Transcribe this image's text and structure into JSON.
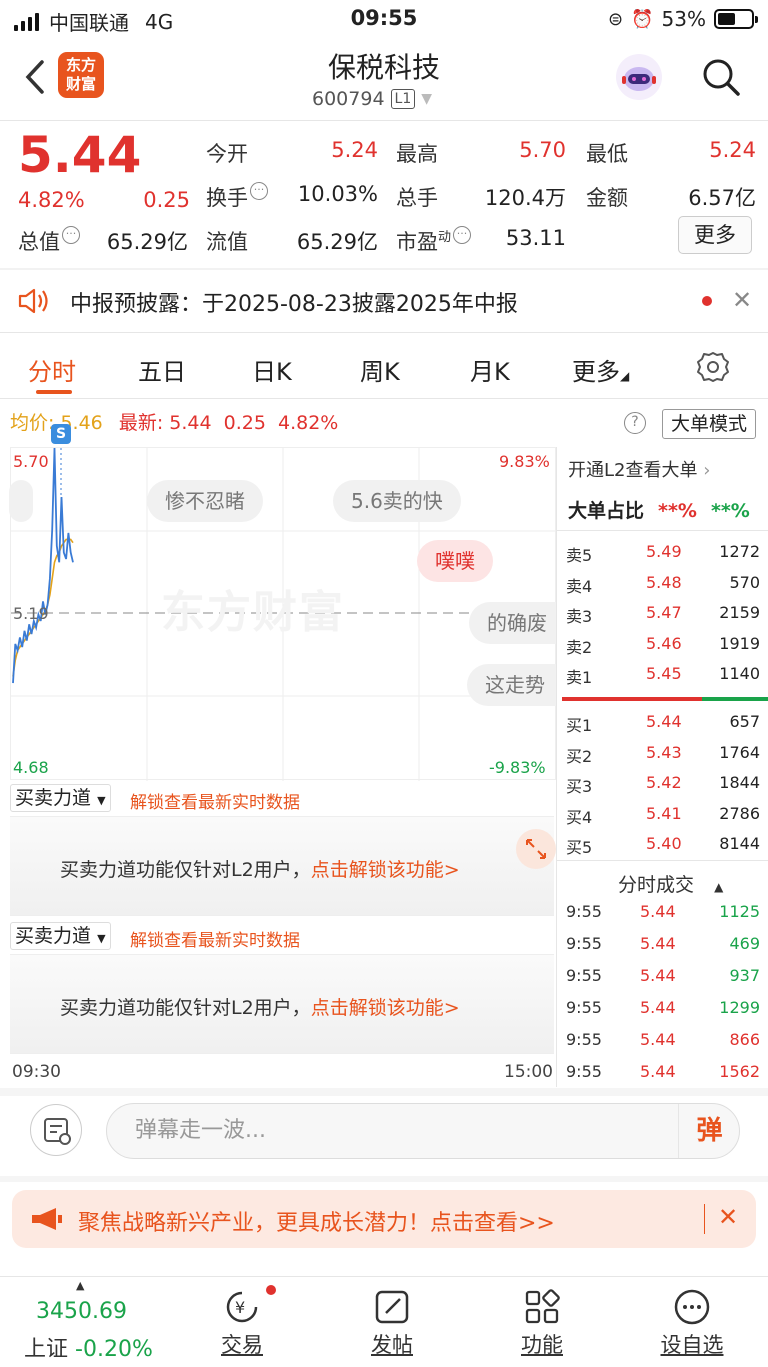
{
  "status": {
    "carrier": "中国联通",
    "network": "4G",
    "time": "09:55",
    "battery": "53%"
  },
  "header": {
    "logo": [
      "东方",
      "财富"
    ],
    "title": "保税科技",
    "code": "600794",
    "level": "L1"
  },
  "quote": {
    "price": "5.44",
    "change_pct": "4.82%",
    "change": "0.25",
    "row1": [
      {
        "l": "今开",
        "v": "5.24"
      },
      {
        "l": "最高",
        "v": "5.70"
      },
      {
        "l": "最低",
        "v": "5.24"
      }
    ],
    "row2": [
      {
        "l": "换手",
        "v": "10.03%"
      },
      {
        "l": "总手",
        "v": "120.4万"
      },
      {
        "l": "金额",
        "v": "6.57亿"
      }
    ],
    "row3": [
      {
        "l": "总值",
        "v": "65.29亿"
      },
      {
        "l": "流值",
        "v": "65.29亿"
      },
      {
        "l": "市盈",
        "sup": "动",
        "v": "53.11"
      }
    ],
    "more": "更多"
  },
  "notice": {
    "text": "中报预披露：于2025-08-23披露2025年中报"
  },
  "tabs": [
    "分时",
    "五日",
    "日K",
    "周K",
    "月K",
    "更多"
  ],
  "chart_info": {
    "avg_label": "均价:",
    "avg": "5.46",
    "latest_label": "最新:",
    "latest": "5.44",
    "chg": "0.25",
    "pct": "4.82%",
    "mode": "大单模式"
  },
  "chart": {
    "y_high": "5.70",
    "y_mid": "5.19",
    "y_low": "4.68",
    "pct_high": "9.83%",
    "pct_low": "-9.83%",
    "t_start": "09:30",
    "t_end": "15:00",
    "watermark": "东方财富",
    "badge": "S",
    "danmu": [
      "惨不忍睹",
      "5.6卖的快",
      "噗噗",
      "的确废",
      "这走势"
    ]
  },
  "chart_data": {
    "type": "line",
    "ylim": [
      4.68,
      5.7
    ],
    "series": [
      {
        "values": [
          4.98,
          5.1,
          5.08,
          5.12,
          5.09,
          5.14,
          5.11,
          5.16,
          5.13,
          5.17,
          5.15,
          5.19,
          5.17,
          5.23,
          5.19,
          5.22,
          5.3,
          5.45,
          5.7,
          5.4,
          5.35,
          5.55,
          5.38,
          5.36,
          5.44,
          5.38,
          5.35
        ]
      },
      {
        "values": [
          5.0,
          5.05,
          5.08,
          5.09,
          5.1,
          5.11,
          5.12,
          5.13,
          5.14,
          5.15,
          5.16,
          5.17,
          5.18,
          5.19,
          5.2,
          5.22,
          5.25,
          5.3,
          5.35,
          5.37,
          5.38,
          5.4,
          5.41,
          5.42,
          5.42,
          5.42,
          5.41
        ]
      }
    ]
  },
  "book": {
    "l2": "开通L2查看大单",
    "ratio_label": "大单占比",
    "ratio_red": "**%",
    "ratio_green": "**%",
    "asks": [
      {
        "n": "卖5",
        "p": "5.49",
        "v": "1272"
      },
      {
        "n": "卖4",
        "p": "5.48",
        "v": "570"
      },
      {
        "n": "卖3",
        "p": "5.47",
        "v": "2159"
      },
      {
        "n": "卖2",
        "p": "5.46",
        "v": "1919"
      },
      {
        "n": "卖1",
        "p": "5.45",
        "v": "1140"
      }
    ],
    "bids": [
      {
        "n": "买1",
        "p": "5.44",
        "v": "657"
      },
      {
        "n": "买2",
        "p": "5.43",
        "v": "1764"
      },
      {
        "n": "买3",
        "p": "5.42",
        "v": "1844"
      },
      {
        "n": "买4",
        "p": "5.41",
        "v": "2786"
      },
      {
        "n": "买5",
        "p": "5.40",
        "v": "8144"
      }
    ],
    "ticks_title": "分时成交",
    "ticks": [
      {
        "t": "9:55",
        "p": "5.44",
        "v": "1125",
        "c": "g"
      },
      {
        "t": "9:55",
        "p": "5.44",
        "v": "469",
        "c": "g"
      },
      {
        "t": "9:55",
        "p": "5.44",
        "v": "937",
        "c": "g"
      },
      {
        "t": "9:55",
        "p": "5.44",
        "v": "1299",
        "c": "g"
      },
      {
        "t": "9:55",
        "p": "5.44",
        "v": "866",
        "c": "r"
      },
      {
        "t": "9:55",
        "p": "5.44",
        "v": "1562",
        "c": "r"
      }
    ]
  },
  "l2panel": {
    "select": "买卖力道",
    "unlock": "解锁查看最新实时数据",
    "msg": "买卖力道功能仅针对L2用户，",
    "link": "点击解锁该功能>"
  },
  "comment": {
    "placeholder": "弹幕走一波...",
    "btn": "弹"
  },
  "banner": {
    "text": "聚焦战略新兴产业，更具成长潜力！点击查看>>"
  },
  "nav": {
    "index_value": "3450.69",
    "index_name": "上证",
    "index_chg": "-0.20%",
    "items": [
      "交易",
      "发帖",
      "功能",
      "设自选"
    ]
  },
  "colors": {
    "up": "#e0322e",
    "down": "#1aa34a",
    "accent": "#e8541e",
    "avg": "#e3a21a",
    "line": "#3a7bd5"
  }
}
